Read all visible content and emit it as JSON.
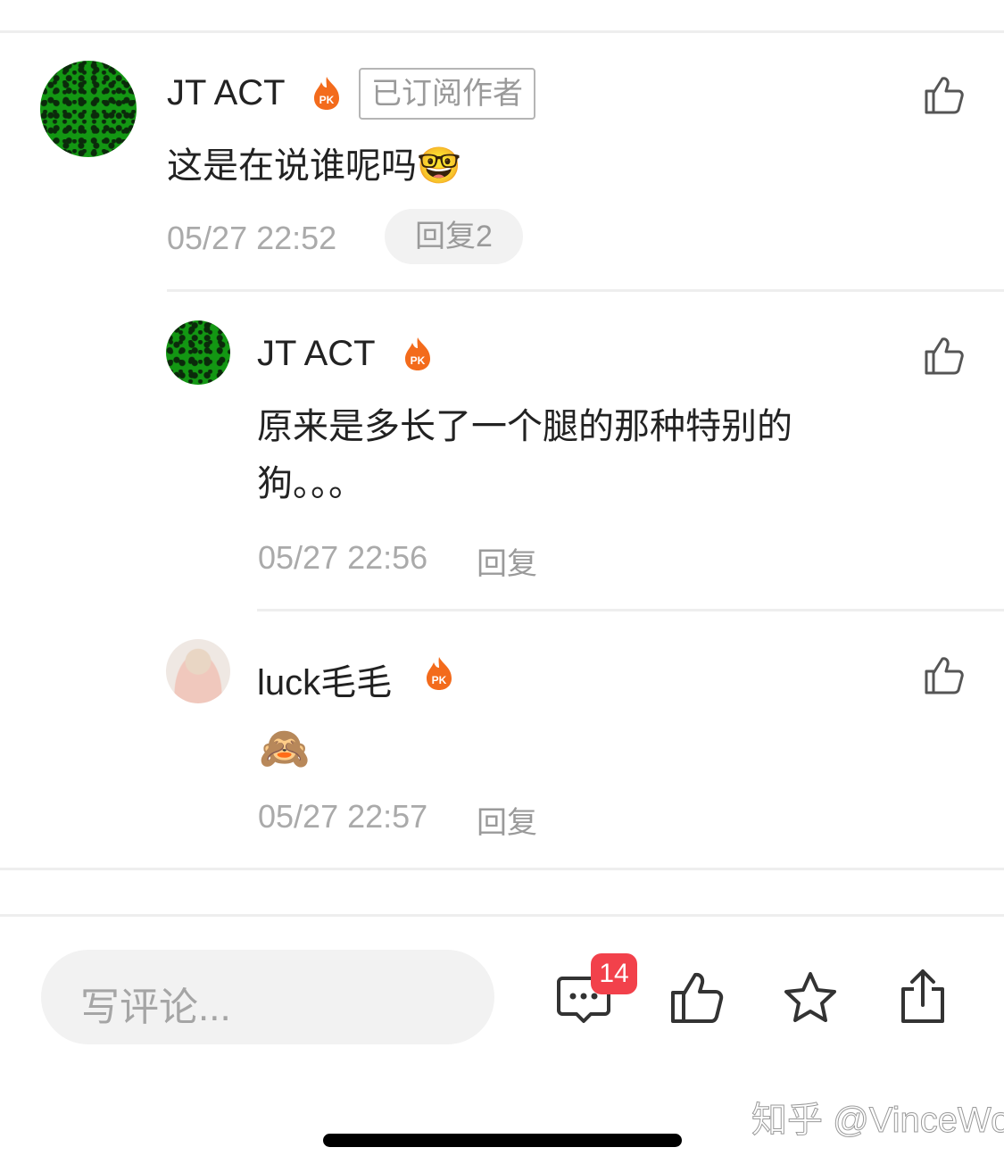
{
  "comments": [
    {
      "name": "JT ACT",
      "badge": "已订阅作者",
      "text": "这是在说谁呢吗",
      "emoji": "🤓",
      "time": "05/27 22:52",
      "reply_label": "回复2"
    },
    {
      "name": "JT ACT",
      "text": "原来是多长了一个腿的那种特别的狗。。。",
      "time": "05/27 22:56",
      "reply_label": "回复"
    },
    {
      "name": "luck毛毛",
      "emoji": "🙈",
      "time": "05/27 22:57",
      "reply_label": "回复"
    }
  ],
  "bottom_bar": {
    "comment_placeholder": "写评论...",
    "comment_count": "14",
    "icons": [
      "comment-icon",
      "like-icon",
      "star-icon",
      "share-icon"
    ]
  },
  "watermark": "知乎 @VinceWolf",
  "colors": {
    "badge_red": "#f2414b",
    "fire_orange": "#f36b1c",
    "muted_text": "#aaaaaa"
  }
}
